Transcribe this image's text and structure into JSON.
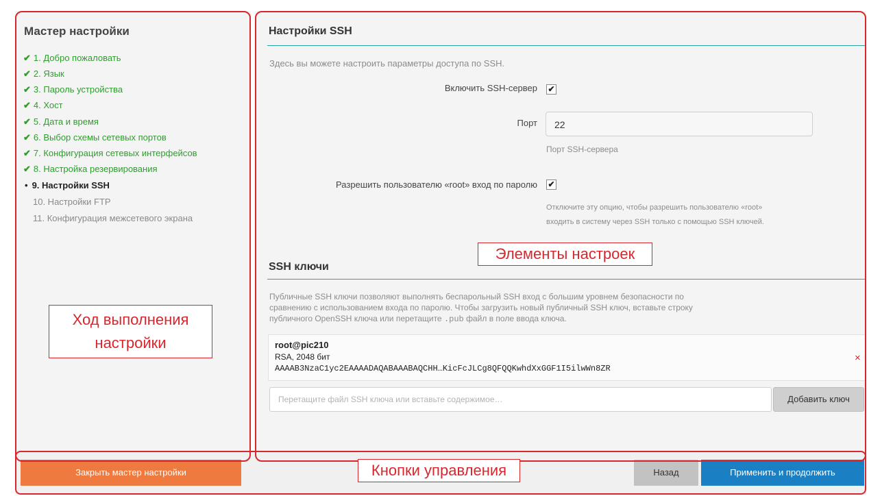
{
  "wizard": {
    "title": "Мастер настройки",
    "steps": [
      {
        "label": "1. Добро пожаловать",
        "status": "done"
      },
      {
        "label": "2. Язык",
        "status": "done"
      },
      {
        "label": "3. Пароль устройства",
        "status": "done"
      },
      {
        "label": "4. Хост",
        "status": "done"
      },
      {
        "label": "5. Дата и время",
        "status": "done"
      },
      {
        "label": "6. Выбор схемы сетевых портов",
        "status": "done"
      },
      {
        "label": "7. Конфигурация сетевых интерфейсов",
        "status": "done"
      },
      {
        "label": "8. Настройка резервирования",
        "status": "done"
      },
      {
        "label": "9. Настройки SSH",
        "status": "current"
      },
      {
        "label": "10. Настройки FTP",
        "status": "todo"
      },
      {
        "label": "11. Конфигурация межсетевого экрана",
        "status": "todo"
      }
    ],
    "done_mark": "✔",
    "current_mark": "•"
  },
  "ssh": {
    "title": "Настройки SSH",
    "description": "Здесь вы можете настроить параметры доступа по SSH.",
    "enable_label": "Включить SSH-сервер",
    "enable_checked": true,
    "port_label": "Порт",
    "port_value": "22",
    "port_help": "Порт SSH-сервера",
    "root_login_label": "Разрешить пользователю «root» вход по паролю",
    "root_login_checked": true,
    "root_help_line1": "Отключите эту опцию, чтобы разрешить пользователю «root»",
    "root_help_line2": "входить в систему через SSH только с помощью SSH ключей."
  },
  "ssh_keys": {
    "title": "SSH ключи",
    "description_line1": "Публичные SSH ключи позволяют выполнять беспарольный SSH вход с большим уровнем безопасности по",
    "description_line2": "сравнению с использованием входа по паролю. Чтобы загрузить новый публичный SSH ключ, вставьте строку",
    "description_line3_pre": "публичного OpenSSH ключа или перетащите",
    "description_line3_code": ".pub",
    "description_line3_post": "файл в поле ввода ключа.",
    "key": {
      "name": "root@pic210",
      "type": "RSA, 2048 бит",
      "fingerprint": "AAAAB3NzaC1yc2EAAAADAQABAAABAQCHH…KicFcJLCg8QFQQKwhdXxGGF1I5ilwWn8ZR",
      "remove_glyph": "×"
    },
    "input_placeholder": "Перетащите файл SSH ключа или вставьте содержимое…",
    "add_button": "Добавить ключ"
  },
  "footer": {
    "close_button": "Закрыть мастер настройки",
    "back_button": "Назад",
    "apply_button": "Применить и продолжить"
  },
  "annotations": {
    "settings": "Элементы настроек",
    "progress_line1": "Ход выполнения",
    "progress_line2": "настройки",
    "controls": "Кнопки управления"
  },
  "colors": {
    "done_step": "#2e9d2e",
    "accent_line": "#2aa3a3",
    "close_button": "#ee7a3f",
    "back_button": "#c2c2c2",
    "apply_button": "#1b7fc4",
    "annotation": "#d9262c"
  }
}
